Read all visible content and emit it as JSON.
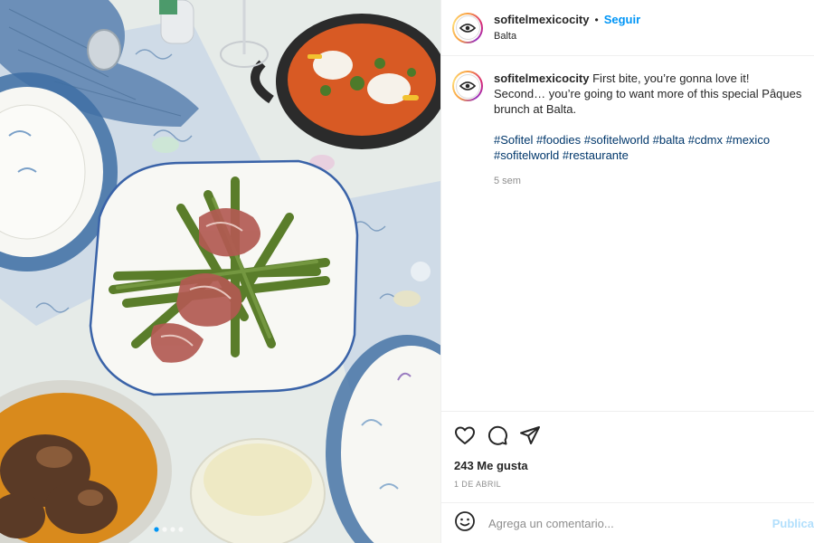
{
  "post": {
    "username": "sofitelmexicocity",
    "separator": "•",
    "follow_label": "Seguir",
    "location": "Balta",
    "avatar_icon": "eye-logo-icon",
    "caption": {
      "username": "sofitelmexicocity",
      "text_line1": " First bite, you’re gonna love it!",
      "text_line2": "Second… you’re going to want more of this special Pâques brunch at Balta.",
      "hashtags": [
        "#Sofitel",
        "#foodies",
        "#sofitelworld",
        "#balta",
        "#cdmx",
        "#mexico",
        "#sofitelworld",
        "#restaurante"
      ],
      "time_ago": "5 sem"
    },
    "actions": {
      "like_icon": "heart-icon",
      "comment_icon": "comment-bubble-icon",
      "share_icon": "paper-plane-icon"
    },
    "likes_label": "243 Me gusta",
    "date_label": "1 DE ABRIL",
    "comment_box": {
      "emoji_icon": "smiley-icon",
      "placeholder": "Agrega un comentario...",
      "post_label": "Publicar"
    }
  },
  "photo": {
    "carousel_total": 4,
    "carousel_active": 1,
    "colors": {
      "tablecloth": "#e8ece9",
      "blue_pattern": "#3e6ea3",
      "plate": "#f6f6f2",
      "asparagus": "#5a7d2a",
      "ham": "#b25a52",
      "sauce": "#d85a24",
      "pot": "#2b2b2b"
    }
  }
}
